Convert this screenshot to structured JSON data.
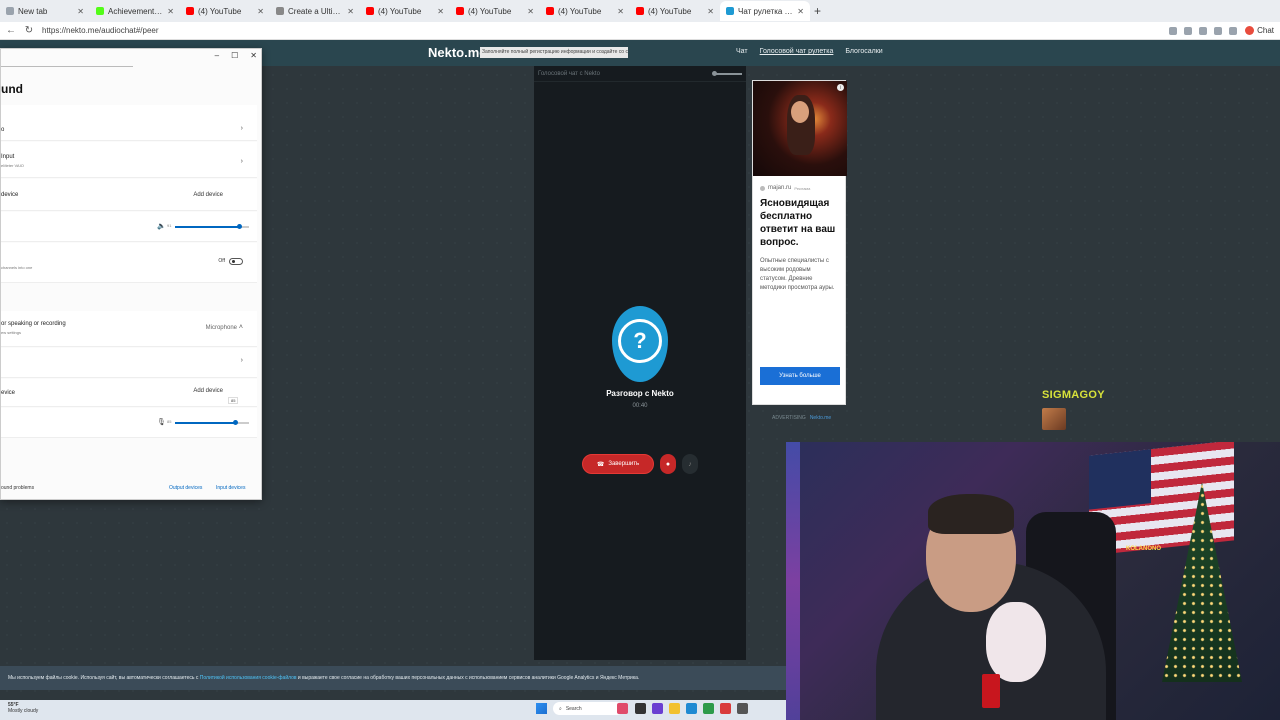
{
  "browser": {
    "tabs": [
      {
        "label": "New tab",
        "color": "#9aa3ad"
      },
      {
        "label": "Achievements - Kick Dashboard",
        "color": "#53fc18"
      },
      {
        "label": "(4) YouTube",
        "color": "#ff0000"
      },
      {
        "label": "Create a Ultimate Fruit - Labeled",
        "color": "#888888"
      },
      {
        "label": "(4) YouTube",
        "color": "#ff0000"
      },
      {
        "label": "(4) YouTube",
        "color": "#ff0000"
      },
      {
        "label": "(4) YouTube",
        "color": "#ff0000"
      },
      {
        "label": "(4) YouTube",
        "color": "#ff0000"
      },
      {
        "label": "Чат рулетка голосовая — N...",
        "color": "#1e9ad3"
      }
    ],
    "new_tab": "+",
    "url": "https://nekto.me/audiochat#/peer",
    "profile_label": "Chat"
  },
  "site": {
    "logo": "Nekto.me",
    "notice": "Заполняйте полный регистрацию информации и создайте со свои ажур",
    "nav": [
      "Чат",
      "Голосовой чат рулетка",
      "Блогосалки"
    ],
    "chat_top_title": "Голосовой чат с Nekto",
    "chat_title": "Разговор с Nekto",
    "chat_timer": "00:40",
    "end_call_label": "Завершить",
    "accent": "#1e9ad3"
  },
  "ad": {
    "source": "majan.ru",
    "source_sub": "Реклама",
    "headline": "Ясновидящая бесплатно ответит на ваш вопрос.",
    "description": "Опытные специалисты с высоким родовым статусом. Древние методики просмотра ауры.",
    "cta": "Узнать больше",
    "footer_left": "ADVERTISING",
    "footer_right": "Nekto.me"
  },
  "settings": {
    "heading": "und",
    "rows": {
      "output_choose": "o",
      "output_device": "Input",
      "output_device_sub": "eMeter VAIO",
      "pair_label": "device",
      "pair_button": "Add device",
      "volume_out": "91",
      "mono_sub": "channels into one",
      "mono_state": "Off",
      "input_title": "or speaking or recording",
      "input_sub": "ew settings",
      "input_selected": "Microphone",
      "pair_in_label": "evice",
      "pair_in_button": "Add device",
      "volume_in": "85",
      "volume_in_tooltip": "85"
    },
    "footer_left": "ound problems",
    "footer_output": "Output devices",
    "footer_input": "Input devices"
  },
  "stream": {
    "username": "SIGMAGOY",
    "neon_sign": "KOLANONO"
  },
  "cookie": {
    "text_before": "Мы используем файлы cookie. Используя сайт, вы автоматически соглашаетесь с",
    "link": "Политикой использования cookie-файлов",
    "text_after": "и выражаете свое согласие на обработку ваших персональных данных с использованием сервисов аналитики Google Analytics и Яндекс Метрика."
  },
  "taskbar": {
    "temp": "55°F",
    "condition": "Mostly cloudy",
    "search": "Search"
  }
}
